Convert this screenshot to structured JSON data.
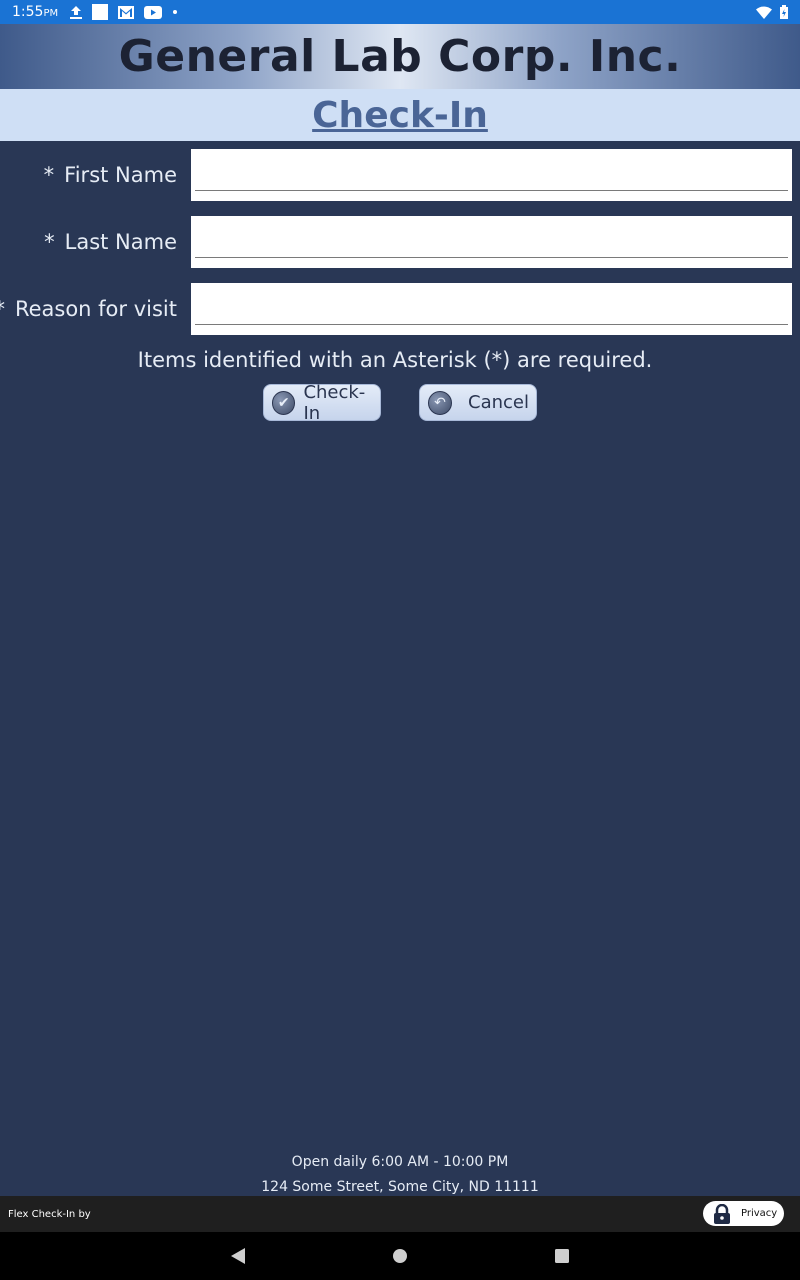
{
  "status_bar": {
    "time": "1:55",
    "time_suffix": "PM",
    "icons_left": [
      "upload-icon",
      "blank-notification-icon",
      "gmail-icon",
      "youtube-icon",
      "dot-icon"
    ],
    "icons_right": [
      "wifi-icon",
      "battery-icon"
    ]
  },
  "header": {
    "title": "General Lab Corp. Inc."
  },
  "subheader": {
    "title": "Check-In"
  },
  "form": {
    "fields": [
      {
        "label": "First Name",
        "required_mark": "*",
        "value": "",
        "placeholder": ""
      },
      {
        "label": "Last Name",
        "required_mark": "*",
        "value": "",
        "placeholder": ""
      },
      {
        "label": "Reason for visit",
        "required_mark": "*",
        "value": "",
        "placeholder": ""
      }
    ],
    "required_note": "Items identified with an Asterisk (*) are required.",
    "checkin_button": "Check-In",
    "cancel_button": "Cancel"
  },
  "footer": {
    "hours": "Open daily 6:00 AM - 10:00 PM",
    "address": "124 Some Street, Some City, ND 11111",
    "powered_by": "Flex Check-In by",
    "privacy_label": "Privacy"
  },
  "colors": {
    "background": "#293755",
    "status_bar": "#1a73d4",
    "subheader_bg": "#cfdff5",
    "subheader_text": "#4a6596"
  }
}
